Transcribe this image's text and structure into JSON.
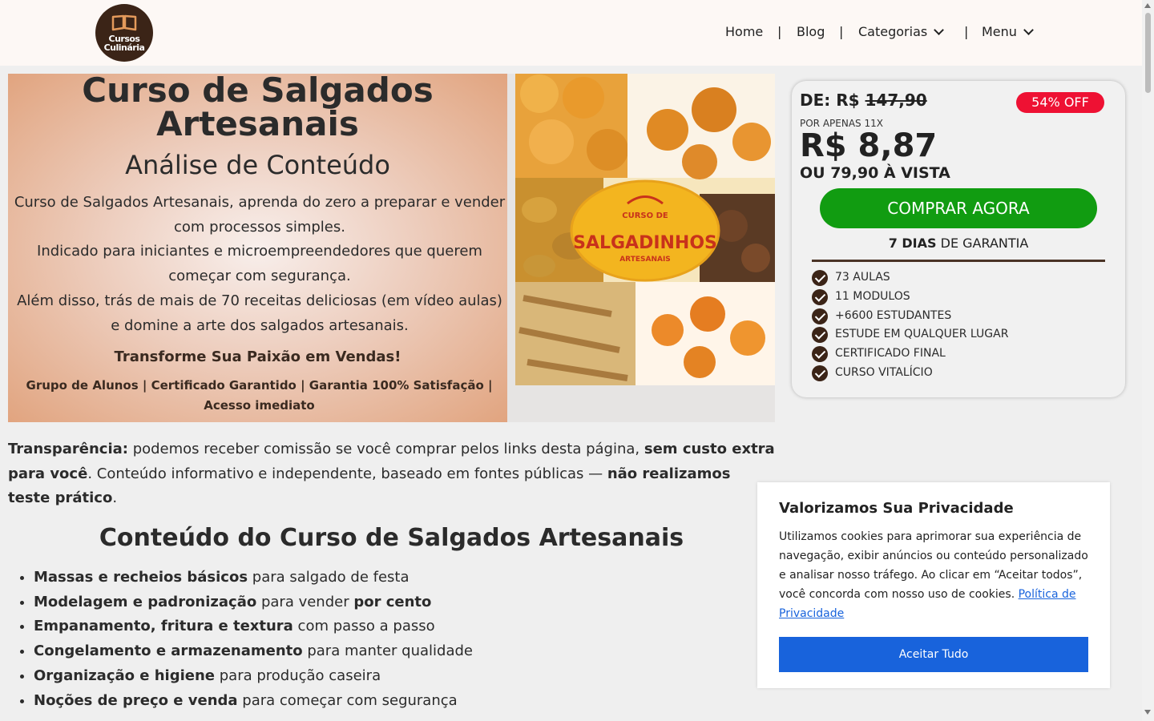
{
  "header": {
    "logo": {
      "line1": "Cursos",
      "line2": "Culinária"
    },
    "nav": [
      {
        "label": "Home"
      },
      {
        "label": "Blog"
      },
      {
        "label": "Categorias",
        "has_dropdown": true
      },
      {
        "label": "Menu",
        "has_dropdown": true
      }
    ],
    "separator": "|"
  },
  "hero": {
    "title": "Curso de Salgados Artesanais",
    "subtitle": "Análise de Conteúdo",
    "description": [
      "Curso de Salgados Artesanais, aprenda do zero a preparar e vender com processos simples.",
      "Indicado para iniciantes e microempreendedores que querem começar com segurança.",
      "Além disso, trás de mais de 70 receitas deliciosas (em vídeo aulas) e domine a arte dos salgados artesanais."
    ],
    "cta": "Transforme Sua Paixão em Vendas!",
    "features": "Grupo de Alunos | Certificado Garantido | Garantia 100% Satisfação | Acesso imediato",
    "image": {
      "line1": "CURSO DE",
      "line2": "SALGADINHOS",
      "line3": "ARTESANAIS"
    }
  },
  "pricing": {
    "de_label": "DE: R$",
    "old_price": "147,90",
    "discount": "54% OFF",
    "installment_label": "POR APENAS 11X",
    "price": "R$ 8,87",
    "cash_price": "OU 79,90 À VISTA",
    "buy_label": "COMPRAR AGORA",
    "guarantee_bold": "7 DIAS",
    "guarantee_rest": " DE GARANTIA",
    "items": [
      "73 AULAS",
      "11 MODULOS",
      "+6600 ESTUDANTES",
      "ESTUDE EM QUALQUER LUGAR",
      "CERTIFICADO FINAL",
      "CURSO VITALÍCIO"
    ]
  },
  "transparency": {
    "label": "Transparência:",
    "text1": " podemos receber comissão se você comprar pelos links desta página, ",
    "bold1": "sem custo extra para você",
    "text2": ". Conteúdo informativo e independente, baseado em fontes públicas — ",
    "bold2": "não realizamos teste prático",
    "text3": "."
  },
  "content": {
    "heading": "Conteúdo do Curso de Salgados Artesanais",
    "items": [
      {
        "bold": "Massas e recheios básicos",
        "text": " para salgado de festa"
      },
      {
        "bold": "Modelagem e padronização",
        "text": " para vender ",
        "bold2": "por cento"
      },
      {
        "bold": "Empanamento, fritura e textura",
        "text": " com passo a passo"
      },
      {
        "bold": "Congelamento e armazenamento",
        "text": " para manter qualidade"
      },
      {
        "bold": "Organização e higiene",
        "text": " para produção caseira"
      },
      {
        "bold": "Noções de preço e venda",
        "text": " para começar com segurança"
      }
    ]
  },
  "cookie": {
    "title": "Valorizamos Sua Privacidade",
    "text": "Utilizamos cookies para aprimorar sua experiência de navegação, exibir anúncios ou conteúdo personalizado e analisar nosso tráfego. Ao clicar em “Aceitar todos”, você concorda com nosso uso de cookies. ",
    "link": "Política de Privacidade",
    "button": "Aceitar Tudo"
  },
  "colors": {
    "buy": "#119c11",
    "discount": "#ee1133",
    "accept": "#1863dc",
    "brand": "#3b2417"
  },
  "icons": [
    "open-book-icon",
    "chevron-down-icon",
    "check-circle-icon"
  ]
}
